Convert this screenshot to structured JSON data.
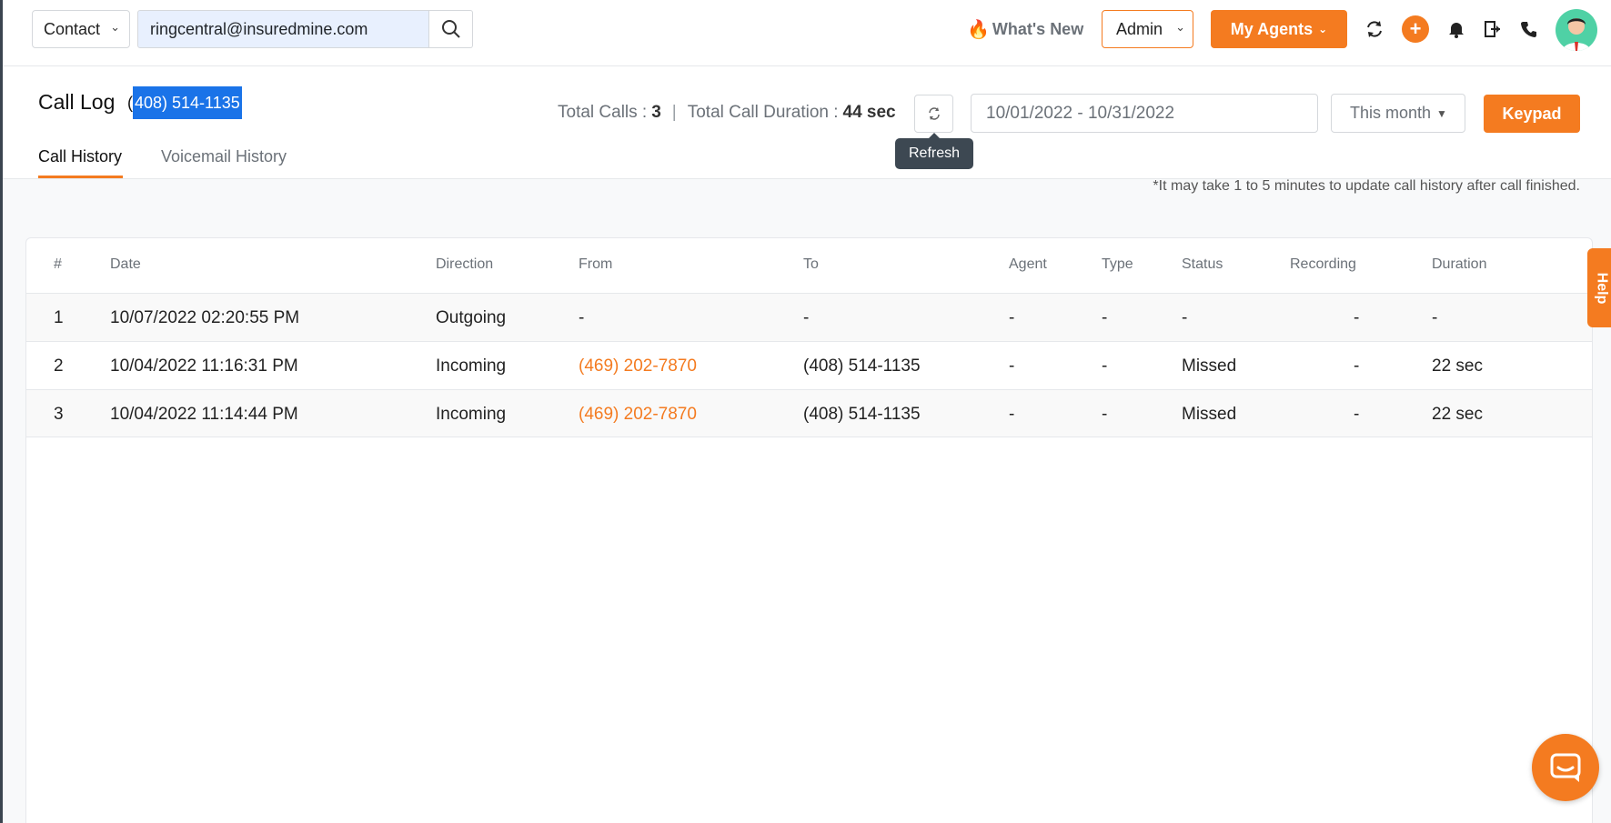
{
  "topbar": {
    "contact_select": "Contact",
    "search_value": "ringcentral@insuredmine.com",
    "whats_new": "What's New",
    "admin_select": "Admin",
    "my_agents": "My Agents"
  },
  "header": {
    "title": "Call Log",
    "phone_prefix": "(",
    "phone_selected": "408) 514-1135",
    "total_calls_label": "Total Calls :",
    "total_calls_value": "3",
    "total_duration_label": "Total Call Duration :",
    "total_duration_value": "44 sec",
    "refresh_tooltip": "Refresh",
    "date_range": "10/01/2022 - 10/31/2022",
    "period": "This month",
    "keypad": "Keypad"
  },
  "tabs": [
    {
      "label": "Call History",
      "active": true
    },
    {
      "label": "Voicemail History",
      "active": false
    }
  ],
  "note": "*It may take 1 to 5 minutes to update call history after call finished.",
  "table": {
    "headers": [
      "#",
      "Date",
      "Direction",
      "From",
      "To",
      "Agent",
      "Type",
      "Status",
      "Recording",
      "Duration"
    ],
    "rows": [
      {
        "num": "1",
        "date": "10/07/2022 02:20:55 PM",
        "direction": "Outgoing",
        "from": "-",
        "to": "-",
        "agent": "-",
        "type": "-",
        "status": "-",
        "recording": "-",
        "duration": "-"
      },
      {
        "num": "2",
        "date": "10/04/2022 11:16:31 PM",
        "direction": "Incoming",
        "from": "(469) 202-7870",
        "to": "(408) 514-1135",
        "agent": "-",
        "type": "-",
        "status": "Missed",
        "recording": "-",
        "duration": "22 sec"
      },
      {
        "num": "3",
        "date": "10/04/2022 11:14:44 PM",
        "direction": "Incoming",
        "from": "(469) 202-7870",
        "to": "(408) 514-1135",
        "agent": "-",
        "type": "-",
        "status": "Missed",
        "recording": "-",
        "duration": "22 sec"
      }
    ]
  },
  "help_tab": "Help",
  "colors": {
    "accent": "#f47b20",
    "selection": "#1a73e8",
    "tooltip_bg": "#3d4852"
  }
}
